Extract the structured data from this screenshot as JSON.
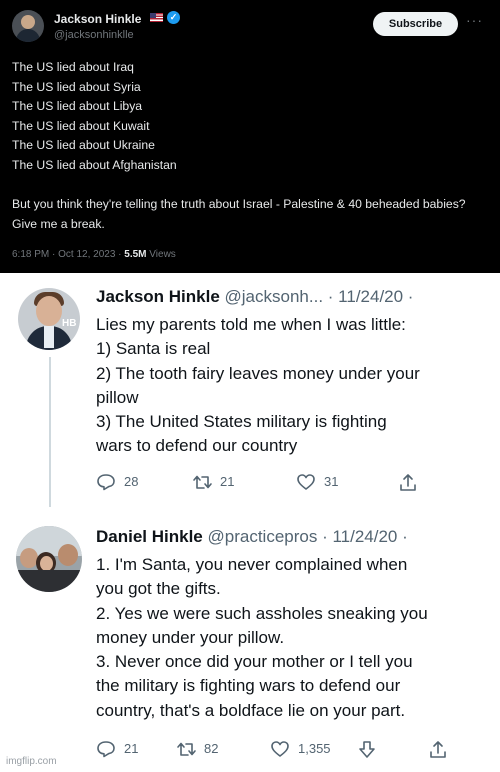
{
  "top_tweet": {
    "author_name": "Jackson Hinkle",
    "author_handle": "@jacksonhinklle",
    "subscribe_label": "Subscribe",
    "more_label": "···",
    "lines": [
      "The US lied about Iraq",
      "The US lied about Syria",
      "The US lied about Libya",
      "The US lied about Kuwait",
      "The US lied about Ukraine",
      "The US lied about Afghanistan"
    ],
    "paragraph": "But you think they're telling the truth about Israel - Palestine & 40 beheaded babies? Give me a break.",
    "timestamp": "6:18 PM · Oct 12, 2023 · ",
    "views_count": "5.5M",
    "views_label": " Views"
  },
  "tweet_1": {
    "author_name": "Jackson Hinkle",
    "author_handle": "@jacksonh...",
    "date": "· 11/24/20 ·",
    "lines": [
      "Lies my parents told me when I was little:",
      "1) Santa is real",
      "2) The tooth fairy leaves money under your",
      "pillow",
      "3) The United States military is fighting",
      "wars to defend our country"
    ],
    "avatar_badge": "HB",
    "replies": "28",
    "retweets": "21",
    "likes": "31"
  },
  "tweet_2": {
    "author_name": "Daniel Hinkle",
    "author_handle": "@practicepros",
    "date": "· 11/24/20 ·",
    "lines": [
      "1. I'm Santa, you never complained when",
      "you got the gifts.",
      "2. Yes we were such assholes sneaking you",
      "money under your pillow.",
      "3. Never once did your mother or I tell you",
      "the military is fighting wars to defend our",
      "country, that's a boldface lie on your part."
    ],
    "replies": "21",
    "retweets": "82",
    "likes": "1,355"
  },
  "watermark": "imgflip.com",
  "colors": {
    "dark_bg": "#000000",
    "verified_blue": "#1d9bf0",
    "secondary_text": "#536471",
    "thread_line": "#cfd9de"
  },
  "icons": [
    "verified-badge-icon",
    "flag-us-icon",
    "reply-icon",
    "retweet-icon",
    "like-icon",
    "share-icon",
    "download-icon"
  ]
}
